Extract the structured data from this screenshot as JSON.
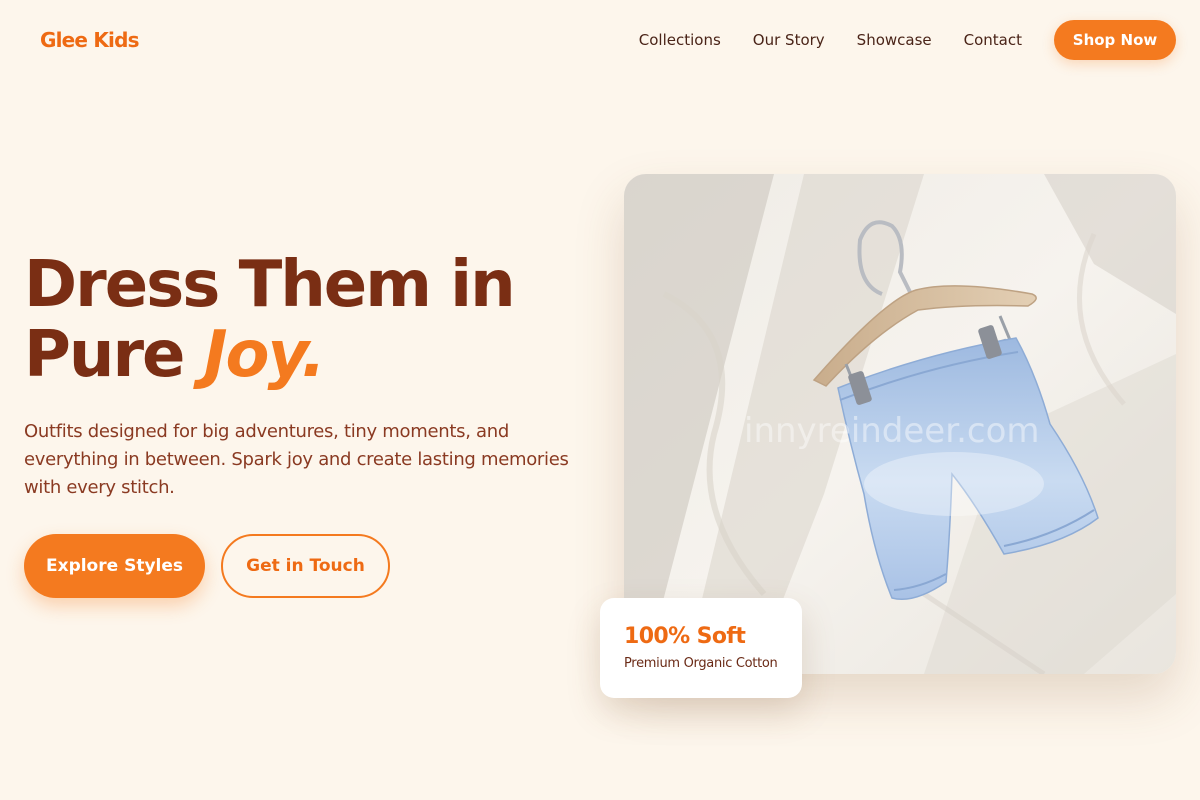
{
  "brand": {
    "logo": "Glee Kids"
  },
  "nav": {
    "links": [
      "Collections",
      "Our Story",
      "Showcase",
      "Contact"
    ],
    "cta": "Shop Now"
  },
  "hero": {
    "title_line1": "Dress Them in",
    "title_line2_prefix": "Pure ",
    "title_accent": "Joy.",
    "description": "Outfits designed for big adventures, tiny moments, and everything in between. Spark joy and create lasting memories with every stitch.",
    "primary_button": "Explore Styles",
    "secondary_button": "Get in Touch"
  },
  "photo": {
    "watermark": "innyreindeer.com"
  },
  "badge": {
    "title": "100% Soft",
    "subtitle": "Premium Organic Cotton"
  },
  "colors": {
    "background": "#fdf6ec",
    "accent": "#f47a1f",
    "heading": "#7a2e14",
    "text": "#8a3a22"
  }
}
